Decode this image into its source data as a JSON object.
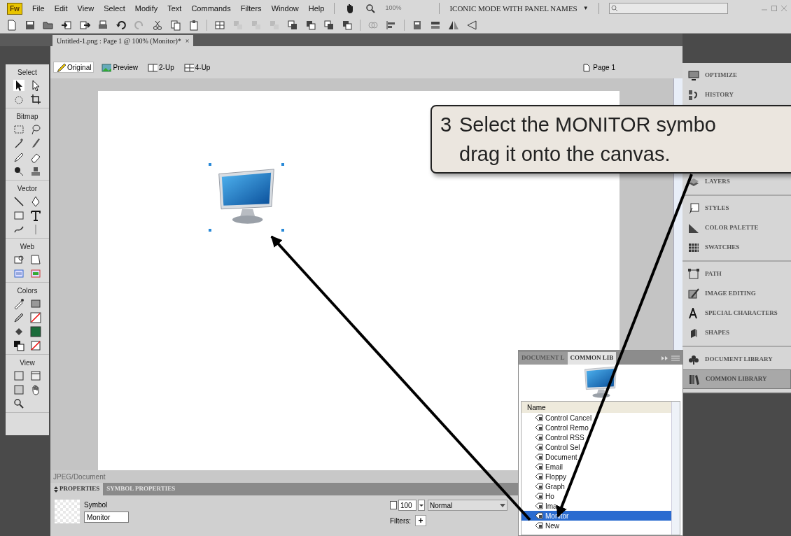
{
  "menu_bar": {
    "logo": "Fw",
    "items": [
      "File",
      "Edit",
      "View",
      "Select",
      "Modify",
      "Text",
      "Commands",
      "Filters",
      "Window",
      "Help"
    ],
    "zoom": "100%",
    "workspace": "ICONIC MODE WITH PANEL NAMES",
    "workspace_caret": "▼"
  },
  "document_tab": {
    "title": "Untitled-1.png : Page 1 @ 100% (Monitor)*",
    "close": "×"
  },
  "tools_panel": {
    "sections": [
      "Select",
      "Bitmap",
      "Vector",
      "Web",
      "Colors",
      "View"
    ]
  },
  "view_bar": {
    "modes": [
      {
        "label": "Original",
        "selected": true
      },
      {
        "label": "Preview",
        "selected": false
      },
      {
        "label": "2-Up",
        "selected": false
      },
      {
        "label": "4-Up",
        "selected": false
      }
    ],
    "page": "Page 1"
  },
  "status_bar": "JPEG/Document",
  "properties": {
    "tabs": [
      {
        "label": "PROPERTIES",
        "selected": true
      },
      {
        "label": "SYMBOL PROPERTIES",
        "selected": false
      }
    ],
    "type_label": "Symbol",
    "name_value": "Monitor",
    "opacity": "100",
    "blend_mode": "Normal",
    "filters_label": "Filters:",
    "add_filter": "+"
  },
  "library": {
    "tabs": [
      {
        "label": "DOCUMENT L",
        "selected": false
      },
      {
        "label": "COMMON LIB",
        "selected": true
      }
    ],
    "column": "Name",
    "items": [
      {
        "label": "Control Cancel",
        "selected": false
      },
      {
        "label": "Control Remo",
        "selected": false
      },
      {
        "label": "Control RSS",
        "selected": false
      },
      {
        "label": "Control Sel",
        "selected": false
      },
      {
        "label": "Document",
        "selected": false
      },
      {
        "label": "Email",
        "selected": false
      },
      {
        "label": "Floppy",
        "selected": false
      },
      {
        "label": "Graph",
        "selected": false
      },
      {
        "label": "Ho",
        "selected": false
      },
      {
        "label": "Ima",
        "selected": false
      },
      {
        "label": "Monitor",
        "selected": true
      },
      {
        "label": "New",
        "selected": false
      }
    ]
  },
  "panel_dock": {
    "groups": [
      {
        "items": [
          {
            "label": "OPTIMIZE",
            "selected": false
          },
          {
            "label": "HISTORY",
            "selected": false
          }
        ]
      },
      {
        "items": [
          {
            "label": "LAYERS",
            "selected": false
          }
        ]
      },
      {
        "items": [
          {
            "label": "STYLES",
            "selected": false
          },
          {
            "label": "COLOR PALETTE",
            "selected": false
          },
          {
            "label": "SWATCHES",
            "selected": false
          }
        ]
      },
      {
        "items": [
          {
            "label": "PATH",
            "selected": false
          },
          {
            "label": "IMAGE EDITING",
            "selected": false
          },
          {
            "label": "SPECIAL CHARACTERS",
            "selected": false
          },
          {
            "label": "SHAPES",
            "selected": false
          }
        ]
      },
      {
        "items": [
          {
            "label": "DOCUMENT LIBRARY",
            "selected": false
          },
          {
            "label": "COMMON LIBRARY",
            "selected": true
          }
        ]
      }
    ]
  },
  "callout": {
    "number": "3",
    "lines": [
      "Select the MONITOR symbo",
      "drag it onto the canvas."
    ]
  }
}
